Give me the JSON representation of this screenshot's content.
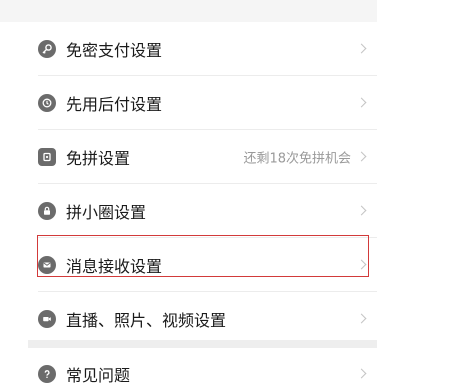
{
  "settings": {
    "items": [
      {
        "label": "免密支付设置",
        "icon": "key-icon",
        "note": ""
      },
      {
        "label": "先用后付设置",
        "icon": "badge-icon",
        "note": ""
      },
      {
        "label": "免拼设置",
        "icon": "coupon-icon",
        "note": "还剩18次免拼机会"
      },
      {
        "label": "拼小圈设置",
        "icon": "lock-icon",
        "note": ""
      },
      {
        "label": "消息接收设置",
        "icon": "message-icon",
        "note": ""
      },
      {
        "label": "直播、照片、视频设置",
        "icon": "video-camera-icon",
        "note": ""
      }
    ]
  },
  "help": {
    "items": [
      {
        "label": "常见问题",
        "icon": "question-icon"
      }
    ]
  },
  "colors": {
    "icon": "#6b6b6b",
    "text": "#1a1a1a",
    "note": "#9a9a9a",
    "highlight": "#d23a3a",
    "background": "#f5f5f5"
  }
}
